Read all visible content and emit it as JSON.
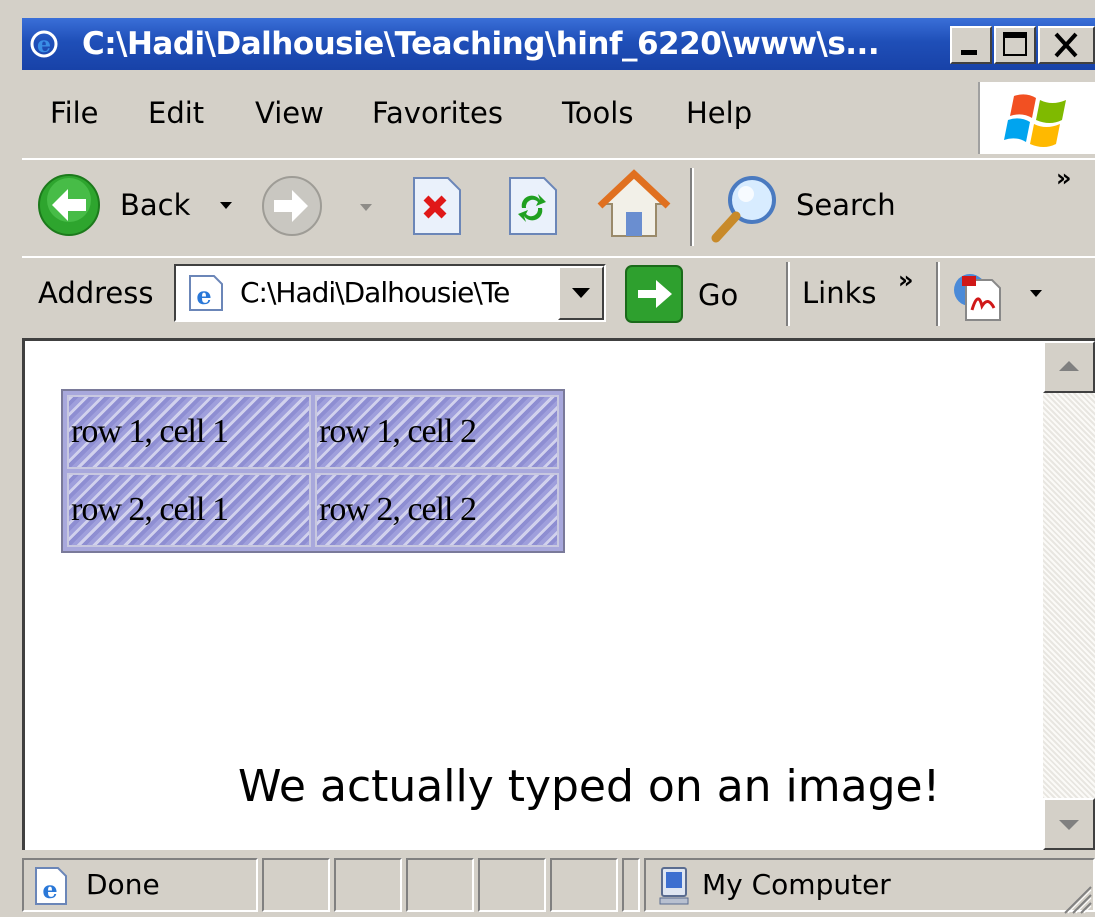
{
  "window": {
    "title": "C:\\Hadi\\Dalhousie\\Teaching\\hinf_6220\\www\\s..."
  },
  "menu": [
    {
      "label": "File"
    },
    {
      "label": "Edit"
    },
    {
      "label": "View"
    },
    {
      "label": "Favorites"
    },
    {
      "label": "Tools"
    },
    {
      "label": "Help"
    }
  ],
  "toolbar": {
    "back_label": "Back",
    "search_label": "Search",
    "chevron": "»"
  },
  "addressbar": {
    "label": "Address",
    "value": "C:\\Hadi\\Dalhousie\\Te",
    "go_label": "Go",
    "links_label": "Links",
    "links_chevron": "»"
  },
  "page": {
    "table": [
      [
        "row 1, cell 1",
        "row 1, cell 2"
      ],
      [
        "row 2, cell 1",
        "row 2, cell 2"
      ]
    ],
    "caption": "We actually typed on an image!"
  },
  "status": {
    "text": "Done",
    "zone": "My Computer"
  },
  "colors": {
    "titlebar": "#2456c4",
    "chrome": "#d4d0c8",
    "table_fill": "#9a9ad8"
  }
}
